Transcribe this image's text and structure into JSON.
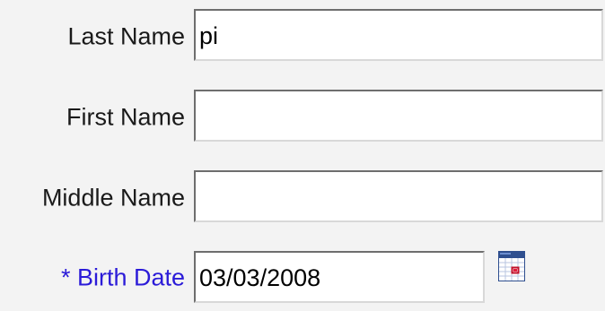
{
  "form": {
    "last_name": {
      "label": "Last Name",
      "value": "pi"
    },
    "first_name": {
      "label": "First Name",
      "value": ""
    },
    "middle_name": {
      "label": "Middle Name",
      "value": ""
    },
    "birth_date": {
      "label": "* Birth Date",
      "value": "03/03/2008"
    },
    "calendar_icon": "calendar-icon",
    "colors": {
      "required_label": "#2b1bd8",
      "label": "#1a1a1a",
      "background": "#f3f3f3"
    }
  }
}
